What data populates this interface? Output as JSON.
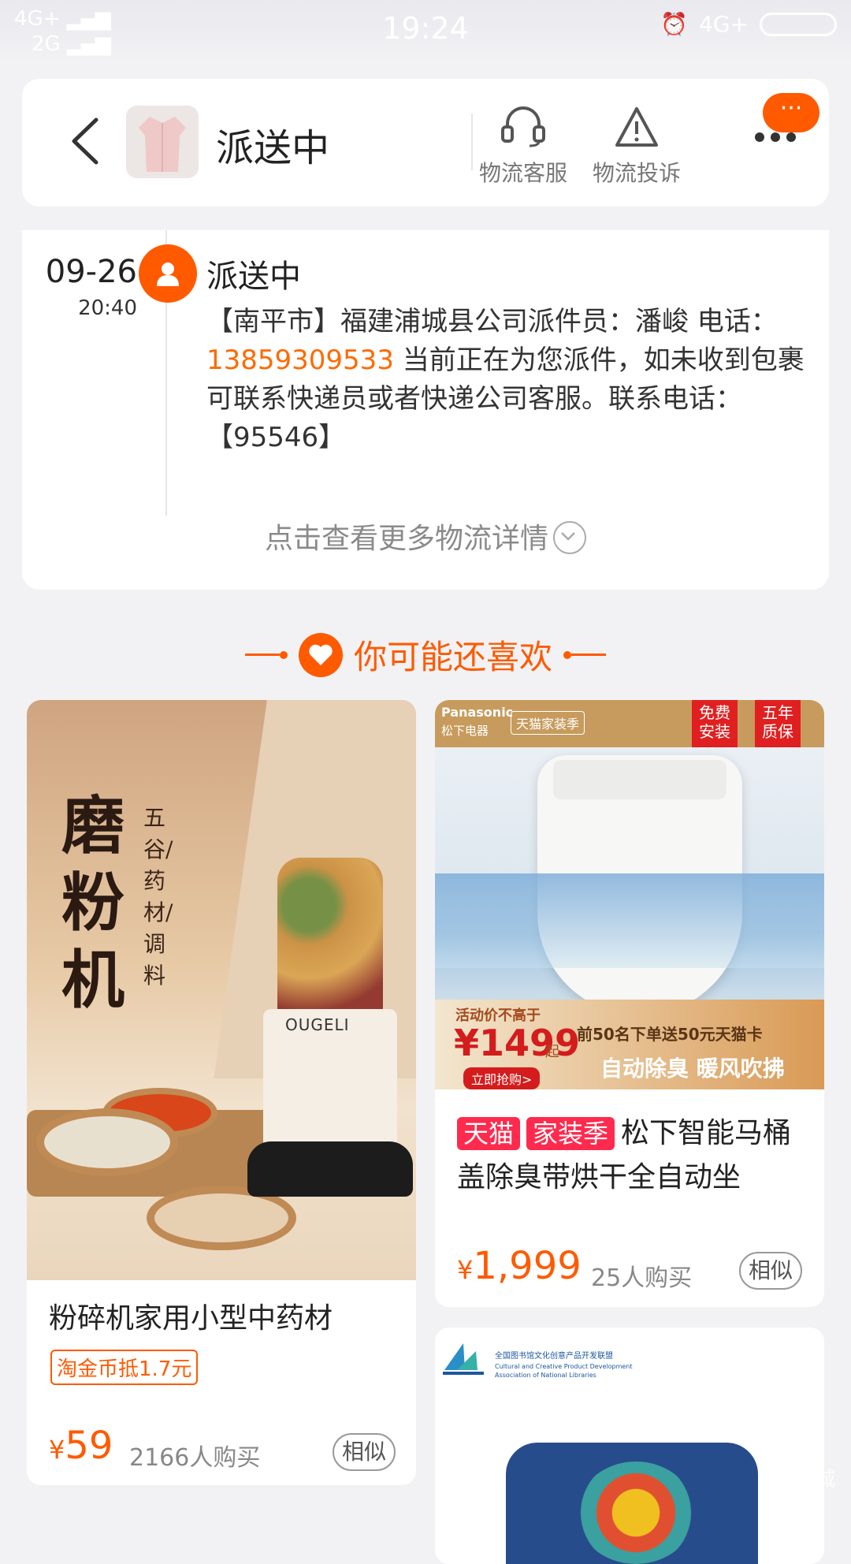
{
  "status_bar": {
    "network1": "4G+",
    "network2": "2G",
    "time": "19:24",
    "network_right": "4G+"
  },
  "header": {
    "title": "派送中",
    "service_label": "物流客服",
    "complaint_label": "物流投诉",
    "badge": "···"
  },
  "tracking": {
    "date": "09-26",
    "time": "20:40",
    "status": "派送中",
    "detail_before": "【南平市】福建浦城县公司派件员：潘峻 电话：",
    "phone": "13859309533",
    "detail_after": " 当前正在为您派件，如未收到包裹可联系快递员或者快递公司客服。联系电话：【95546】",
    "more_link": "点击查看更多物流详情"
  },
  "recommend": {
    "heading": "你可能还喜欢"
  },
  "products": [
    {
      "image_text_main": "磨粉机",
      "image_text_side": "五谷/药材/调料",
      "image_brand": "OUGELI",
      "title": "粉碎机家用小型中药材",
      "coin": "淘金币抵1.7元",
      "price_symbol": "¥",
      "price": "59",
      "sold": "2166人购买",
      "similar": "相似"
    },
    {
      "image_brand": "Panasonic",
      "image_brand_cn": "松下电器",
      "image_tmall": "天猫家装季",
      "image_badge1": "免费安装",
      "image_badge2": "五年质保",
      "image_promo_a": "活动价不高于",
      "image_promo_price": "¥1499",
      "image_promo_suffix": "起",
      "image_promo_btn": "立即抢购>",
      "image_promo_gift": "前50名下单送50元天猫卡",
      "image_promo_feature": "自动除臭 暖风吹拂",
      "tag1": "天猫",
      "tag2": "家装季",
      "title": "松下智能马桶盖除臭带烘干全自动坐",
      "price_symbol": "¥",
      "price": "1,999",
      "sold": "25人购买",
      "similar": "相似"
    },
    {
      "image_org": "全国图书馆文化创意产品开发联盟",
      "image_org_en": "Cultural and Creative Product Development Association of National Libraries"
    }
  ],
  "watermark": "浦城"
}
